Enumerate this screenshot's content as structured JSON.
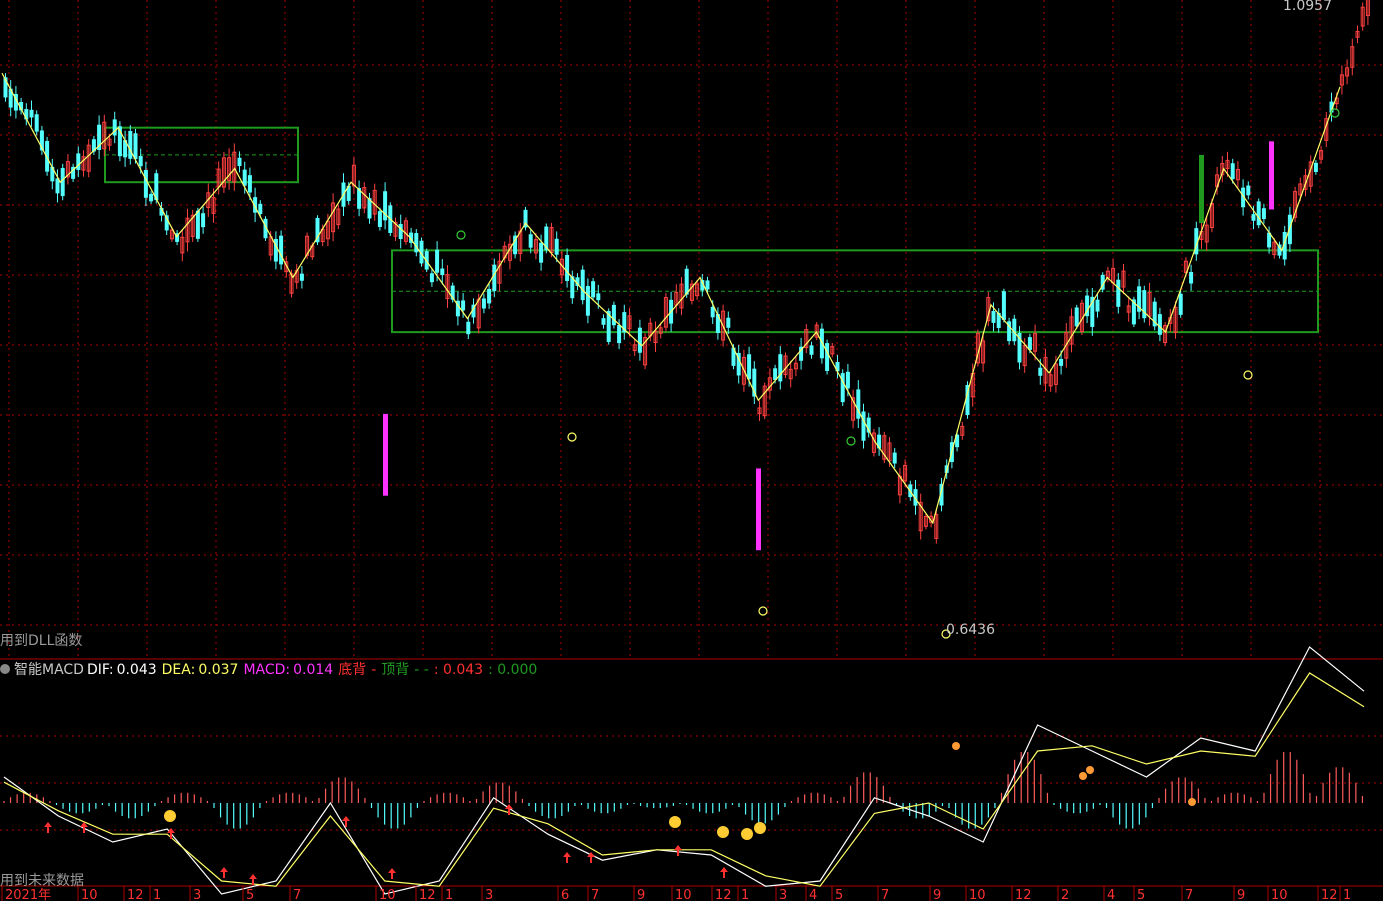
{
  "price_panel": {
    "dll_note": "用到DLL函数",
    "high_label": "1.0957",
    "low_label": "0.6436"
  },
  "indicator_panel": {
    "name": "智能MACD",
    "dif_label": "DIF:",
    "dif_value": "0.043",
    "dea_label": "DEA:",
    "dea_value": "0.037",
    "macd_label": "MACD:",
    "macd_value": "0.014",
    "bottom_div": "底背",
    "sep1": "-",
    "top_div": "顶背",
    "sep2": "- -",
    "extra1": ": 0.043",
    "extra2": ": 0.000",
    "future_note": "用到未来数据"
  },
  "colors": {
    "up": "#ff4040",
    "down": "#54ffff",
    "zigzag": "#ffff66",
    "box": "#1f9a1f",
    "dif": "#ffffff",
    "dea": "#ffff66",
    "macd_label": "#ff33ff",
    "axis": "#b00000"
  },
  "chart_data": [
    {
      "type": "candlestick",
      "title": "",
      "ylim": [
        0.64,
        1.1
      ],
      "annotations": [
        "1.0957",
        "0.6436"
      ],
      "zigzag_y": [
        1.05,
        0.97,
        1.01,
        0.93,
        0.98,
        0.9,
        0.97,
        0.93,
        0.87,
        0.94,
        0.89,
        0.85,
        0.9,
        0.81,
        0.86,
        0.78,
        0.72,
        0.88,
        0.83,
        0.9,
        0.86,
        0.98,
        0.92,
        1.04
      ],
      "boxes": [
        {
          "from": 0.97,
          "to": 1.01
        },
        {
          "from": 0.86,
          "to": 0.92
        }
      ]
    },
    {
      "type": "bar",
      "name": "MACD",
      "x_ticks": [
        "2021年",
        "10",
        "12",
        "1",
        "3",
        "5",
        "7",
        "10",
        "12",
        "1",
        "3",
        "6",
        "7",
        "9",
        "10",
        "12",
        "1",
        "3",
        "4",
        "5",
        "7",
        "9",
        "10",
        "12",
        "2",
        "4",
        "5",
        "7",
        "9",
        "10",
        "12",
        "1"
      ],
      "series": [
        {
          "name": "DIF",
          "values": [
            0.01,
            -0.005,
            -0.015,
            -0.01,
            -0.035,
            -0.03,
            0.0,
            -0.035,
            -0.03,
            0.002,
            -0.012,
            -0.022,
            -0.018,
            -0.02,
            -0.032,
            -0.03,
            0.002,
            -0.005,
            -0.015,
            0.03,
            0.02,
            0.01,
            0.025,
            0.02,
            0.06,
            0.043
          ]
        },
        {
          "name": "DEA",
          "values": [
            0.008,
            -0.003,
            -0.012,
            -0.012,
            -0.03,
            -0.032,
            -0.005,
            -0.03,
            -0.032,
            -0.002,
            -0.008,
            -0.02,
            -0.018,
            -0.018,
            -0.028,
            -0.032,
            -0.004,
            0.0,
            -0.01,
            0.02,
            0.022,
            0.015,
            0.02,
            0.018,
            0.05,
            0.037
          ]
        }
      ],
      "macd_bars": [
        0.004,
        -0.004,
        -0.006,
        0.004,
        -0.01,
        0.004,
        0.01,
        -0.01,
        0.004,
        0.008,
        -0.006,
        -0.004,
        -0.002,
        -0.004,
        -0.008,
        0.004,
        0.012,
        -0.006,
        -0.01,
        0.02,
        -0.004,
        -0.01,
        0.01,
        0.004,
        0.02,
        0.014
      ]
    }
  ]
}
